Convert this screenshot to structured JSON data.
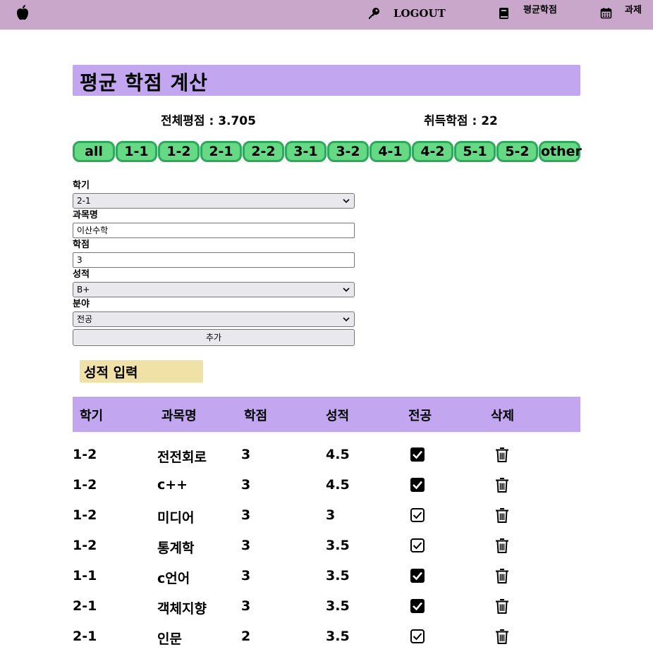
{
  "nav": {
    "logout_label": "LOGOUT",
    "avg_label": "평균학점",
    "task_label": "과제",
    "bg_color": "#c9a7cb",
    "icons": [
      "apple-icon",
      "key-icon",
      "book-icon",
      "calendar-icon"
    ]
  },
  "page": {
    "title": "평균 학점 계산",
    "total_gpa_text": "전체평점 : 3.705",
    "total_credits_text": "취득학점 : 22"
  },
  "filters": [
    "all",
    "1-1",
    "1-2",
    "2-1",
    "2-2",
    "3-1",
    "3-2",
    "4-1",
    "4-2",
    "5-1",
    "5-2",
    "other"
  ],
  "form": {
    "semester_label": "학기",
    "semester_value": "2-1",
    "subject_label": "과목명",
    "subject_value": "이산수학",
    "credit_label": "학점",
    "credit_value": "3",
    "grade_label": "성적",
    "grade_value": "B+",
    "field_label": "분야",
    "field_value": "전공",
    "add_label": "추가"
  },
  "section_title": "성적 입력",
  "table": {
    "headers": [
      "학기",
      "과목명",
      "학점",
      "성적",
      "전공",
      "삭제"
    ],
    "rows": [
      {
        "semester": "1-2",
        "name": "전전회로",
        "credit": "3",
        "grade": "4.5",
        "major": true
      },
      {
        "semester": "1-2",
        "name": "c++",
        "credit": "3",
        "grade": "4.5",
        "major": true
      },
      {
        "semester": "1-2",
        "name": "미디어",
        "credit": "3",
        "grade": "3",
        "major": false
      },
      {
        "semester": "1-2",
        "name": "통계학",
        "credit": "3",
        "grade": "3.5",
        "major": false
      },
      {
        "semester": "1-1",
        "name": "c언어",
        "credit": "3",
        "grade": "3.5",
        "major": true
      },
      {
        "semester": "2-1",
        "name": "객체지향",
        "credit": "3",
        "grade": "3.5",
        "major": true
      },
      {
        "semester": "2-1",
        "name": "인문",
        "credit": "2",
        "grade": "3.5",
        "major": false
      }
    ]
  },
  "colors": {
    "title_bg": "#c3a6f0",
    "pill_bg": "#65d983",
    "pill_border": "#2ea85a",
    "section_bg": "#f0e1a7"
  }
}
